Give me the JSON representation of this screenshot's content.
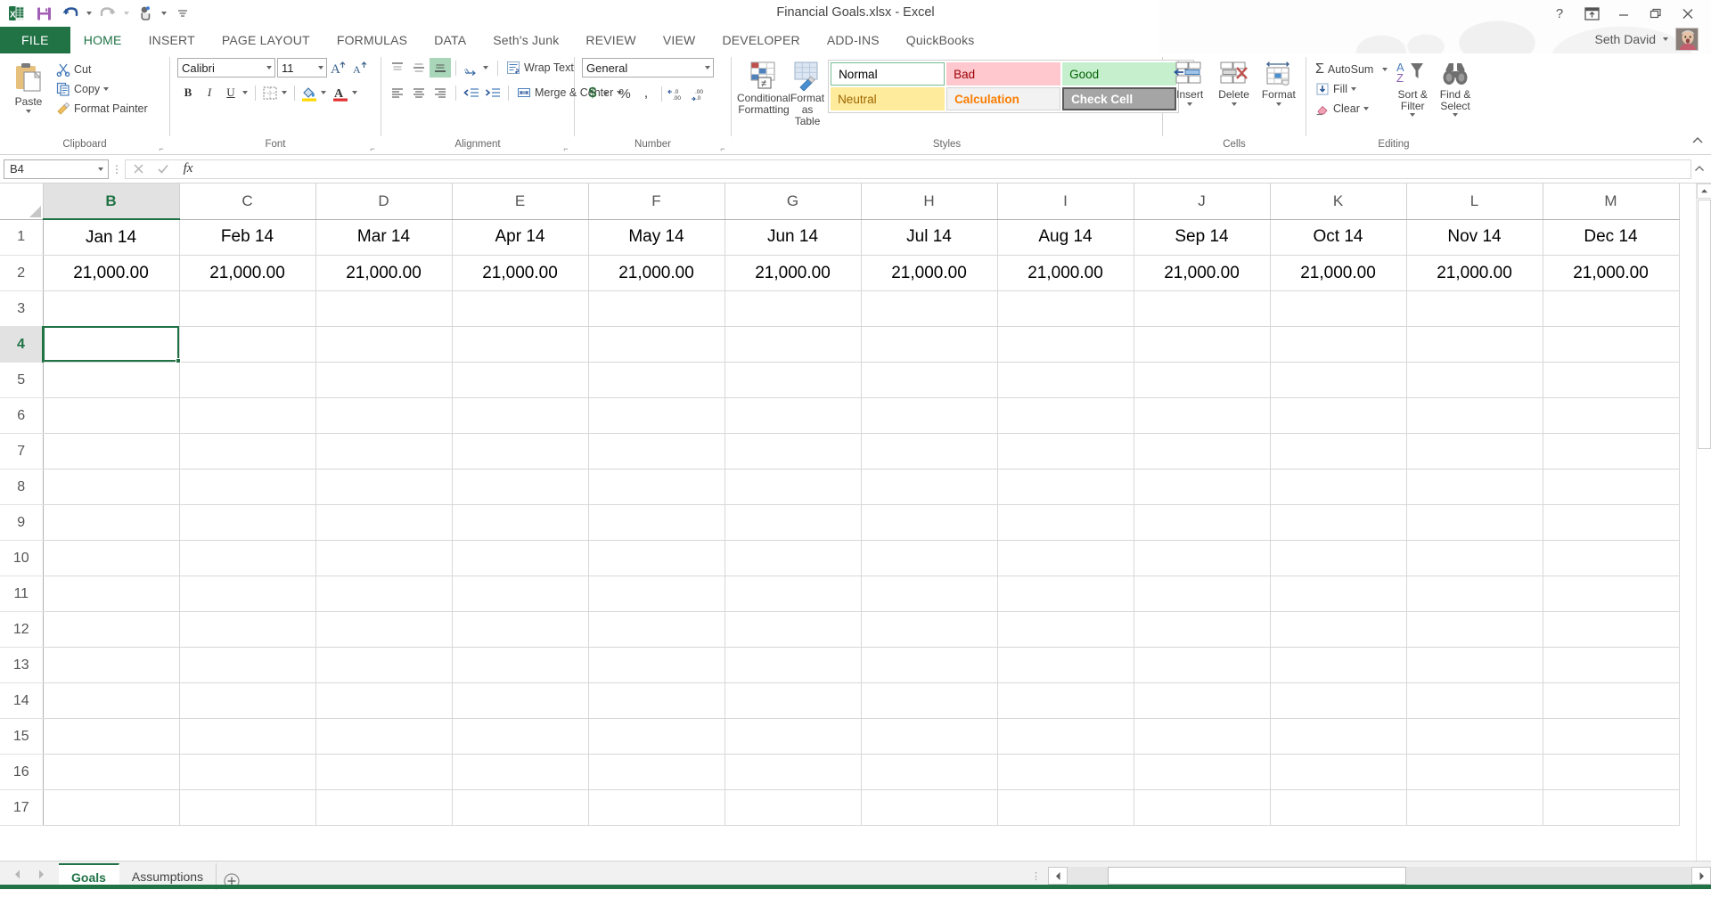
{
  "window": {
    "title": "Financial Goals.xlsx - Excel",
    "help_icon": "question-mark-icon",
    "ribbon_display_icon": "ribbon-display-options-icon",
    "minimize_icon": "minimize-icon",
    "restore_icon": "restore-icon",
    "close_icon": "close-icon",
    "account_name": "Seth David",
    "accent_green": "#217346"
  },
  "quick_access": [
    {
      "name": "excel-logo-icon",
      "label": "Excel"
    },
    {
      "name": "save-icon",
      "label": "Save"
    },
    {
      "name": "undo-icon",
      "label": "Undo"
    },
    {
      "name": "redo-icon",
      "label": "Redo"
    },
    {
      "name": "touch-mode-icon",
      "label": "Touch/Mouse Mode"
    },
    {
      "name": "customize-qat-icon",
      "label": "Customize Quick Access Toolbar"
    }
  ],
  "tabs": [
    {
      "label": "FILE",
      "active": false
    },
    {
      "label": "HOME",
      "active": true
    },
    {
      "label": "INSERT",
      "active": false
    },
    {
      "label": "PAGE LAYOUT",
      "active": false
    },
    {
      "label": "FORMULAS",
      "active": false
    },
    {
      "label": "DATA",
      "active": false
    },
    {
      "label": "Seth's Junk",
      "active": false
    },
    {
      "label": "REVIEW",
      "active": false
    },
    {
      "label": "VIEW",
      "active": false
    },
    {
      "label": "DEVELOPER",
      "active": false
    },
    {
      "label": "ADD-INS",
      "active": false
    },
    {
      "label": "QuickBooks",
      "active": false
    }
  ],
  "ribbon": {
    "clipboard": {
      "label": "Clipboard",
      "paste": "Paste",
      "cut": "Cut",
      "copy": "Copy",
      "format_painter": "Format Painter"
    },
    "font": {
      "label": "Font",
      "font_name": "Calibri",
      "font_size": "11",
      "grow_font": "A",
      "shrink_font": "A",
      "bold": "B",
      "italic": "I",
      "underline": "U"
    },
    "alignment": {
      "label": "Alignment",
      "wrap_text": "Wrap Text",
      "merge_center": "Merge & Center"
    },
    "number": {
      "label": "Number",
      "format": "General",
      "currency": "$",
      "percent": "%",
      "comma": ","
    },
    "styles": {
      "label": "Styles",
      "conditional_formatting": "Conditional Formatting",
      "format_as_table": "Format as Table",
      "cells": [
        {
          "label": "Normal",
          "bg": "#ffffff",
          "fg": "#000000",
          "border": "#76bc93"
        },
        {
          "label": "Bad",
          "bg": "#ffc7ce",
          "fg": "#9c0006",
          "border": "#ffc7ce"
        },
        {
          "label": "Good",
          "bg": "#c6efce",
          "fg": "#006100",
          "border": "#c6efce"
        },
        {
          "label": "Neutral",
          "bg": "#ffeb9c",
          "fg": "#9c6500",
          "border": "#ffeb9c"
        },
        {
          "label": "Calculation",
          "bg": "#f2f2f2",
          "fg": "#fa7d00",
          "border": "#cccccc"
        },
        {
          "label": "Check Cell",
          "bg": "#a5a5a5",
          "fg": "#ffffff",
          "border": "#5a5a5a"
        }
      ]
    },
    "cells": {
      "label": "Cells",
      "insert": "Insert",
      "delete": "Delete",
      "format": "Format"
    },
    "editing": {
      "label": "Editing",
      "autosum": "AutoSum",
      "fill": "Fill",
      "clear": "Clear",
      "sort_filter": "Sort & Filter",
      "find_select": "Find & Select"
    },
    "collapse_icon": "collapse-ribbon-icon"
  },
  "formula_bar": {
    "name_box": "B4",
    "cancel_icon": "cancel-icon",
    "enter_icon": "enter-icon",
    "function_icon": "insert-function-icon",
    "value": "",
    "expand_icon": "expand-formula-bar-icon"
  },
  "sheet": {
    "columns": [
      "B",
      "C",
      "D",
      "E",
      "F",
      "G",
      "H",
      "I",
      "J",
      "K",
      "L",
      "M"
    ],
    "selected_column": "B",
    "rows": [
      1,
      2,
      3,
      4,
      5,
      6,
      7,
      8,
      9,
      10,
      11,
      12,
      13,
      14,
      15,
      16,
      17
    ],
    "selected_row": 4,
    "selected_cell": "B4",
    "row1": [
      "Jan 14",
      "Feb 14",
      "Mar 14",
      "Apr 14",
      "May 14",
      "Jun 14",
      "Jul 14",
      "Aug 14",
      "Sep 14",
      "Oct 14",
      "Nov 14",
      "Dec 14"
    ],
    "row2": [
      "21,000.00",
      "21,000.00",
      "21,000.00",
      "21,000.00",
      "21,000.00",
      "21,000.00",
      "21,000.00",
      "21,000.00",
      "21,000.00",
      "21,000.00",
      "21,000.00",
      "21,000.00"
    ]
  },
  "status": {
    "sheet_tabs": [
      {
        "label": "Goals",
        "active": true
      },
      {
        "label": "Assumptions",
        "active": false
      }
    ],
    "new_sheet_icon": "add-sheet-icon",
    "first_sheet_icon": "previous-sheet-icon",
    "last_sheet_icon": "next-sheet-icon"
  }
}
